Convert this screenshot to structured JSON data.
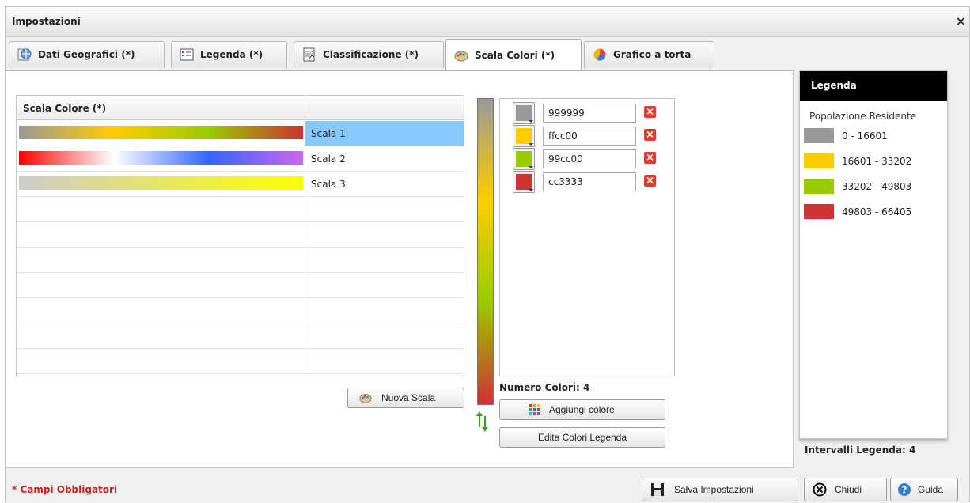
{
  "window": {
    "title": "Impostazioni",
    "close_glyph": "×"
  },
  "tabs": [
    {
      "label": "Dati Geografici (*)",
      "icon": "globe-icon"
    },
    {
      "label": "Legenda (*)",
      "icon": "legend-list-icon"
    },
    {
      "label": "Classificazione (*)",
      "icon": "classification-icon"
    },
    {
      "label": "Scala Colori (*)",
      "icon": "palette-icon",
      "active": true
    },
    {
      "label": "Grafico a torta",
      "icon": "pie-chart-icon"
    }
  ],
  "scales_grid": {
    "header": "Scala Colore (*)",
    "rows": [
      {
        "name": "Scala 1",
        "colors": [
          "#999999",
          "#ffcc00",
          "#99cc00",
          "#cc3333"
        ],
        "selected": true
      },
      {
        "name": "Scala 2",
        "colors": [
          "#ff0000",
          "#ffffff",
          "#3366ff",
          "#cc66ee"
        ]
      },
      {
        "name": "Scala 3",
        "colors": [
          "#cccccc",
          "#ffff00"
        ]
      }
    ],
    "empty_rows": 7,
    "new_button": "Nuova Scala"
  },
  "colors": {
    "items": [
      {
        "hex": "999999",
        "color": "#999999"
      },
      {
        "hex": "ffcc00",
        "color": "#ffcc00"
      },
      {
        "hex": "99cc00",
        "color": "#99cc00"
      },
      {
        "hex": "cc3333",
        "color": "#cc3333"
      }
    ],
    "count_label": "Numero Colori:",
    "count": "4",
    "add_button": "Aggiungi colore",
    "edit_button": "Edita Colori Legenda"
  },
  "legend": {
    "title": "Legenda",
    "subtitle": "Popolazione Residente",
    "items": [
      {
        "label": "0 - 16601",
        "color": "#999999"
      },
      {
        "label": "16601 - 33202",
        "color": "#ffcc00"
      },
      {
        "label": "33202 - 49803",
        "color": "#99cc00"
      },
      {
        "label": "49803 - 66405",
        "color": "#cc3333"
      }
    ],
    "intervals_label": "Intervalli Legenda:",
    "intervals_count": "4"
  },
  "footer": {
    "required_note": "* Campi Obbligatori",
    "save_button": "Salva Impostazioni",
    "close_button": "Chiudi",
    "help_button": "Guida"
  }
}
